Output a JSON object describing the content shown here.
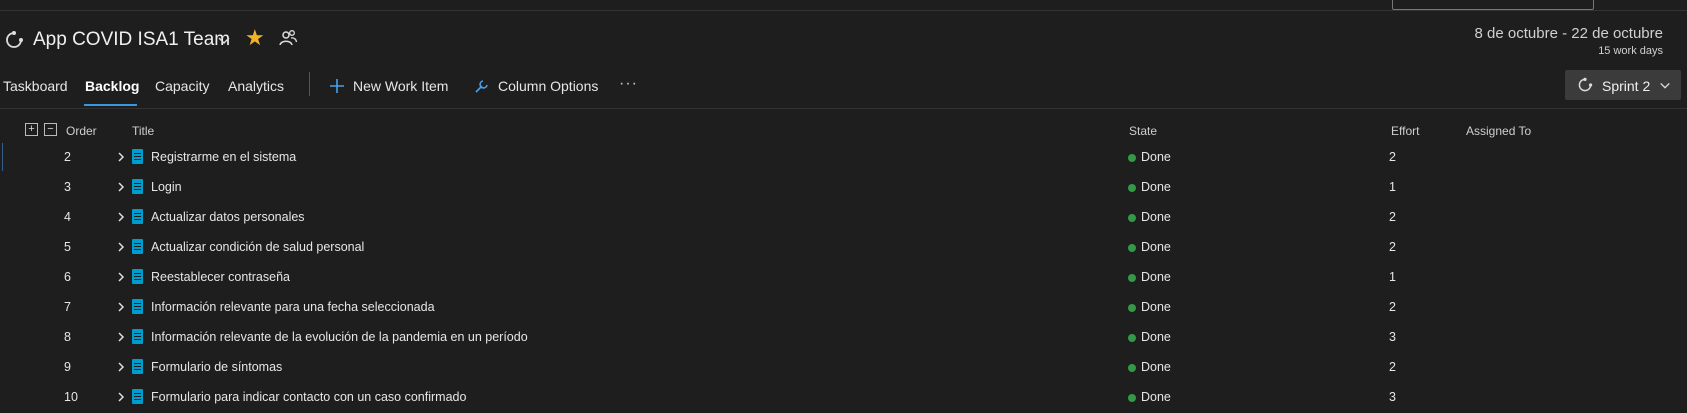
{
  "header": {
    "team_title": "App COVID ISA1 Team",
    "date_range": "8 de octubre - 22 de octubre",
    "work_days": "15 work days"
  },
  "tabs": [
    {
      "label": "Taskboard"
    },
    {
      "label": "Backlog",
      "active": true
    },
    {
      "label": "Capacity"
    },
    {
      "label": "Analytics"
    }
  ],
  "toolbar": {
    "new_work_item": "New Work Item",
    "column_options": "Column Options",
    "more": "···"
  },
  "sprint": {
    "label": "Sprint 2"
  },
  "columns": {
    "order": "Order",
    "title": "Title",
    "state": "State",
    "effort": "Effort",
    "assigned_to": "Assigned To"
  },
  "rows": [
    {
      "order": "2",
      "title": "Registrarme en el sistema",
      "state": "Done",
      "effort": "2"
    },
    {
      "order": "3",
      "title": "Login",
      "state": "Done",
      "effort": "1"
    },
    {
      "order": "4",
      "title": "Actualizar datos personales",
      "state": "Done",
      "effort": "2"
    },
    {
      "order": "5",
      "title": "Actualizar condición de salud personal",
      "state": "Done",
      "effort": "2"
    },
    {
      "order": "6",
      "title": "Reestablecer contraseña",
      "state": "Done",
      "effort": "1"
    },
    {
      "order": "7",
      "title": "Información relevante para una fecha seleccionada",
      "state": "Done",
      "effort": "2"
    },
    {
      "order": "8",
      "title": "Información relevante de la evolución de la pandemia en un período",
      "state": "Done",
      "effort": "3"
    },
    {
      "order": "9",
      "title": "Formulario de síntomas",
      "state": "Done",
      "effort": "2"
    },
    {
      "order": "10",
      "title": "Formulario para indicar contacto con un caso confirmado",
      "state": "Done",
      "effort": "3"
    }
  ],
  "colors": {
    "background": "#1e1e1e",
    "accent": "#3a96dd",
    "star": "#f0b429",
    "done_dot": "#339947",
    "backlog_item_icon": "#009ccc"
  },
  "icons": [
    "sprint-icon",
    "chevron-down-icon",
    "star-icon",
    "people-icon",
    "plus-icon",
    "wrench-icon",
    "more-icon",
    "expand-all-icon",
    "collapse-all-icon",
    "chevron-right-icon",
    "backlog-item-icon"
  ]
}
